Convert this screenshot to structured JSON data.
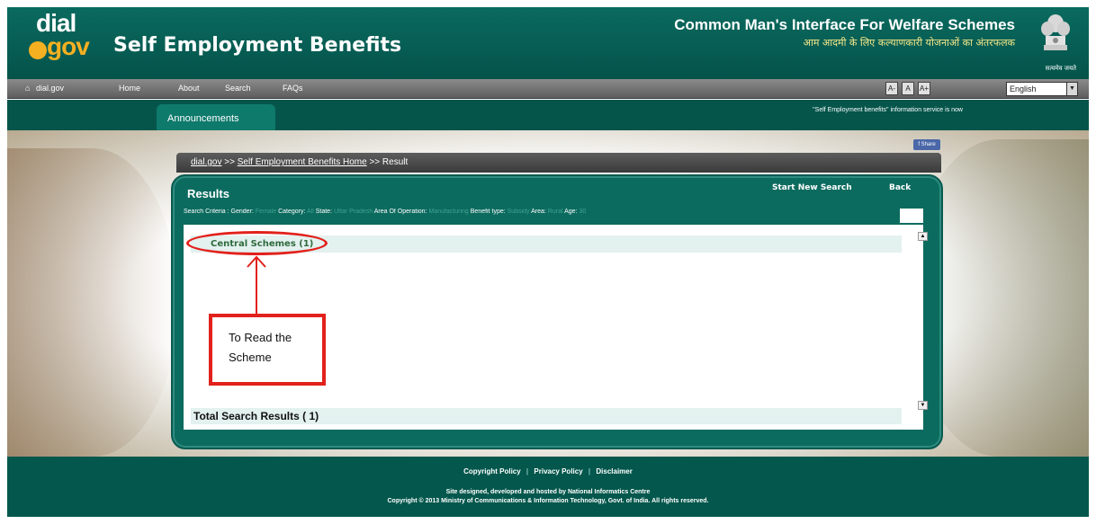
{
  "header": {
    "logo_dial": "dial",
    "logo_gov": "gov",
    "site_title": "Self Employment Benefits",
    "tagline": "Common Man's Interface For Welfare Schemes",
    "tagline_hindi": "आम आदमी के लिए कल्याणकारी योजनाओं का अंतरफलक",
    "emblem_motto": "सत्यमेव जयते"
  },
  "nav": {
    "items": [
      "dial.gov",
      "Home",
      "About",
      "Search",
      "FAQs"
    ],
    "font_buttons": [
      "A-",
      "A",
      "A+"
    ],
    "language": "English"
  },
  "announcements": {
    "tab_label": "Announcements",
    "marquee": "\"Self Employment benefits\" information service is now"
  },
  "share_label": "f Share",
  "breadcrumb": {
    "root": "dial.gov",
    "sep1": ">>",
    "home": "Self Employment Benefits Home",
    "sep2": ">>",
    "current": "Result"
  },
  "results": {
    "title": "Results",
    "start_new_search": "Start New Search",
    "back": "Back",
    "criteria": {
      "label": "Search Criteria :",
      "fields": [
        {
          "name": "Gender:",
          "value": "Female"
        },
        {
          "name": "Category:",
          "value": "All"
        },
        {
          "name": "State:",
          "value": "Uttar Pradesh"
        },
        {
          "name": "Area Of Operation:",
          "value": "Manufacturing"
        },
        {
          "name": "Benefit type:",
          "value": "Subsidy"
        },
        {
          "name": "Area:",
          "value": "Rural"
        },
        {
          "name": "Age:",
          "value": "30"
        }
      ]
    },
    "central_schemes": "Central Schemes (1)",
    "total": "Total Search Results ( 1)"
  },
  "callout": {
    "line1": "To Read the",
    "line2": "Scheme"
  },
  "footer": {
    "links": [
      "Copyright Policy",
      "Privacy Policy",
      "Disclaimer"
    ],
    "line1": "Site designed, developed and hosted by National Informatics Centre",
    "line2": "Copyright © 2013 Ministry of Communications & Information Technology, Govt. of India. All rights reserved."
  },
  "colors": {
    "header_teal": "#0a6a5f",
    "panel_teal": "#0c6b5f",
    "callout_red": "#e2211c",
    "logo_orange": "#f5b021"
  }
}
